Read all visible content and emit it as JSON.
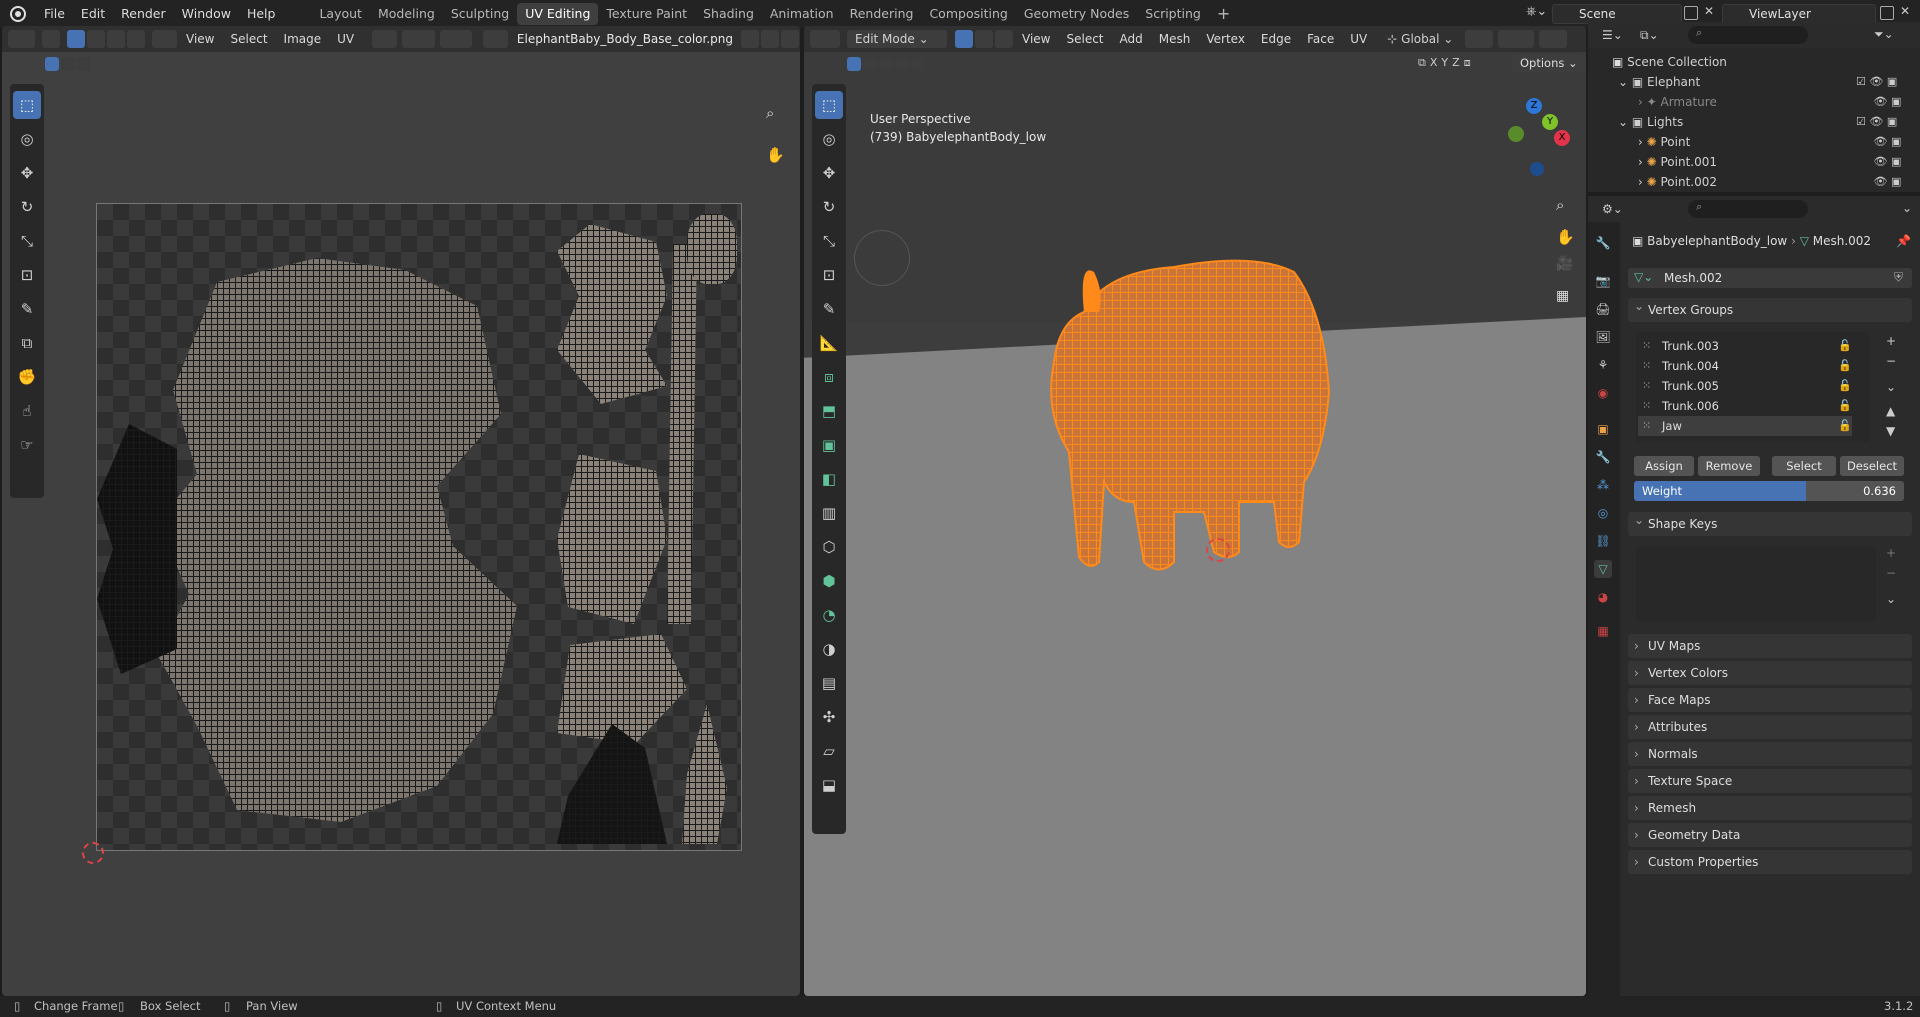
{
  "topbar": {
    "menus": [
      "File",
      "Edit",
      "Render",
      "Window",
      "Help"
    ],
    "workspaces": [
      "Layout",
      "Modeling",
      "Sculpting",
      "UV Editing",
      "Texture Paint",
      "Shading",
      "Animation",
      "Rendering",
      "Compositing",
      "Geometry Nodes",
      "Scripting"
    ],
    "active_workspace": "UV Editing",
    "scene_name": "Scene",
    "view_layer": "ViewLayer"
  },
  "uv_editor": {
    "menus": [
      "View",
      "Select",
      "Image",
      "UV"
    ],
    "image_name": "ElephantBaby_Body_Base_color.png"
  },
  "viewport": {
    "mode": "Edit Mode",
    "menus": [
      "View",
      "Select",
      "Add",
      "Mesh",
      "Vertex",
      "Edge",
      "Face",
      "UV"
    ],
    "orientation": "Global",
    "options_label": "Options",
    "axes": [
      "X",
      "Y",
      "Z"
    ],
    "overlay_title": "User Perspective",
    "overlay_object": "(739) BabyelephantBody_low",
    "gizmo_axes": [
      "Z",
      "X",
      "Y"
    ]
  },
  "outliner": {
    "root": "Scene Collection",
    "items": [
      {
        "label": "Elephant",
        "level": 1
      },
      {
        "label": "Armature",
        "level": 2
      },
      {
        "label": "Lights",
        "level": 1
      },
      {
        "label": "Point",
        "level": 2
      },
      {
        "label": "Point.001",
        "level": 2
      },
      {
        "label": "Point.002",
        "level": 2
      }
    ]
  },
  "properties": {
    "breadcrumb_object": "BabyelephantBody_low",
    "breadcrumb_mesh": "Mesh.002",
    "mesh_name": "Mesh.002",
    "vertex_groups_title": "Vertex Groups",
    "vertex_groups": [
      "Trunk.003",
      "Trunk.004",
      "Trunk.005",
      "Trunk.006",
      "Jaw"
    ],
    "buttons": {
      "assign": "Assign",
      "remove": "Remove",
      "select": "Select",
      "deselect": "Deselect"
    },
    "weight_label": "Weight",
    "weight_value": "0.636",
    "weight_fraction": 0.636,
    "shape_keys_title": "Shape Keys",
    "panels": [
      "UV Maps",
      "Vertex Colors",
      "Face Maps",
      "Attributes",
      "Normals",
      "Texture Space",
      "Remesh",
      "Geometry Data",
      "Custom Properties"
    ]
  },
  "statusbar": {
    "items": [
      "Change Frame",
      "Box Select",
      "Pan View",
      "UV Context Menu"
    ],
    "version": "3.1.2"
  },
  "colors": {
    "accent": "#4772b3",
    "selection_orange": "#ff8a1a",
    "mesh_green": "#61c39a"
  }
}
